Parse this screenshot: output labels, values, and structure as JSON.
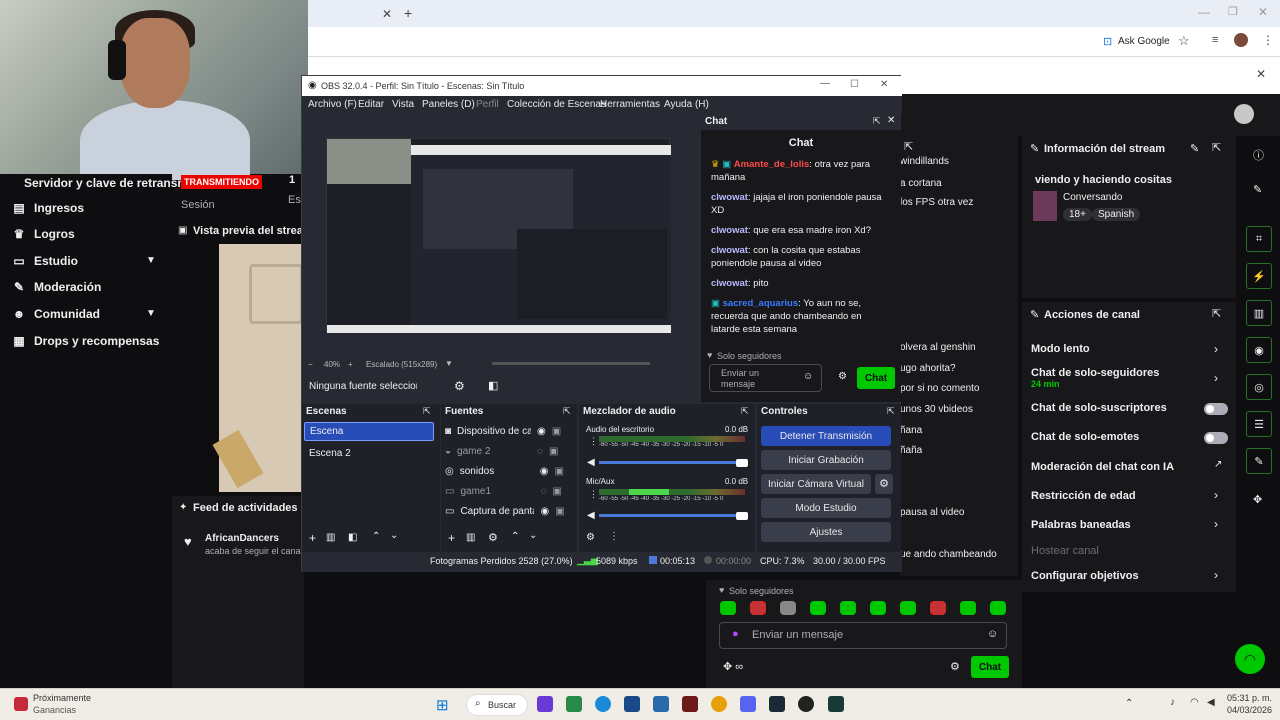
{
  "browser": {
    "ask_google": "Ask Google"
  },
  "webcam": {},
  "twitch": {
    "server_key": "Servidor y clave de retransm",
    "live_badge": "TRANSMITIENDO",
    "count_1": "1",
    "session": "Sesión",
    "session_right": "Es",
    "nav": [
      {
        "label": "Ingresos",
        "icon": "money-icon"
      },
      {
        "label": "Logros",
        "icon": "trophy-icon"
      },
      {
        "label": "Estudio",
        "icon": "studio-icon"
      },
      {
        "label": "Moderación",
        "icon": "wrench-icon"
      },
      {
        "label": "Comunidad",
        "icon": "people-icon"
      },
      {
        "label": "Drops y recompensas",
        "icon": "gift-icon"
      }
    ],
    "preview_title": "Vista previa del stream",
    "feed_title": "Feed de actividades",
    "feed_user": "AfricanDancers",
    "feed_action": "acaba de seguir el canal",
    "stream_info": {
      "title": "Información del stream",
      "stream_title": "viendo y haciendo cositas",
      "category": "Conversando",
      "tags": [
        "18+",
        "Spanish"
      ]
    },
    "channel_actions": {
      "title": "Acciones de canal",
      "items": [
        {
          "label": "Modo lento",
          "control": "chevron"
        },
        {
          "label": "Chat de solo-seguidores",
          "sub": "24 min",
          "control": "chevron"
        },
        {
          "label": "Chat de solo-suscriptores",
          "control": "toggle"
        },
        {
          "label": "Chat de solo-emotes",
          "control": "toggle"
        },
        {
          "label": "Moderación del chat con IA",
          "control": "external"
        },
        {
          "label": "Restricción de edad",
          "control": "chevron"
        },
        {
          "label": "Palabras baneadas",
          "control": "chevron"
        },
        {
          "label": "Hostear canal",
          "control": "none",
          "disabled": true
        },
        {
          "label": "Configurar objetivos",
          "control": "chevron"
        }
      ]
    },
    "behind_chat": {
      "lines": [
        "windillands",
        "a cortana",
        "los FPS otra vez",
        "olvera al genshin",
        "ugo ahorita?",
        "por si no comento",
        "unos 30 vbideos",
        "ñana",
        "ñaña",
        "pausa al video",
        "ue ando chambeando"
      ]
    },
    "bottom_chat": {
      "followers_only": "Solo seguidores",
      "placeholder": "Enviar un mensaje",
      "send": "Chat"
    }
  },
  "obs": {
    "title": "OBS 32.0.4 - Perfil: Sin Título - Escenas: Sin Título",
    "menu": [
      "Archivo (F)",
      "Editar",
      "Vista",
      "Paneles (D)",
      "Perfil",
      "Colección de Escenas",
      "Herramientas",
      "Ayuda (H)"
    ],
    "zoom": "40%",
    "scaling": "Escalado (515x289)",
    "no_source": "Ninguna fuente seleccionad",
    "chat": {
      "dock_title": "Chat",
      "header": "Chat",
      "messages": [
        {
          "user": "Amante_de_lolis",
          "text": ": otra vez para mañana",
          "color": "#ff4a4a"
        },
        {
          "user": "clwowat",
          "text": ": jajaja el iron poniendole pausa XD",
          "color": "#b8b8ff"
        },
        {
          "user": "clwowat",
          "text": ": que era esa madre iron Xd?",
          "color": "#b8b8ff"
        },
        {
          "user": "clwowat",
          "text": ": con la cosita que estabas poniendole pausa al video",
          "color": "#b8b8ff"
        },
        {
          "user": "clwowat",
          "text": ": pito",
          "color": "#b8b8ff"
        },
        {
          "user": "sacred_aquarius",
          "text": ": Yo aun no se, recuerda que ando chambeando en latarde esta semana",
          "color": "#3b7bff"
        }
      ],
      "followers_only": "Solo seguidores",
      "placeholder": "Enviar un mensaje",
      "send": "Chat"
    },
    "scenes": {
      "title": "Escenas",
      "items": [
        "Escena",
        "Escena 2"
      ]
    },
    "sources": {
      "title": "Fuentes",
      "items": [
        {
          "label": "Dispositivo de capt",
          "icon": "camera-icon",
          "visible": true
        },
        {
          "label": "game 2",
          "icon": "gamepad-icon",
          "visible": false
        },
        {
          "label": "sonidos",
          "icon": "audio-icon",
          "visible": true
        },
        {
          "label": "game1",
          "icon": "window-icon",
          "visible": false
        },
        {
          "label": "Captura de pantall",
          "icon": "monitor-icon",
          "visible": true
        }
      ]
    },
    "mixer": {
      "title": "Mezclador de audio",
      "channels": [
        {
          "name": "Audio del escritorio",
          "db": "0.0 dB"
        },
        {
          "name": "Mic/Aux",
          "db": "0.0 dB"
        }
      ],
      "scale": "-60 -55 -50 -45 -40 -35 -30 -25 -20 -15 -10 -5 0"
    },
    "controls": {
      "title": "Controles",
      "buttons": [
        "Detener Transmisión",
        "Iniciar Grabación",
        "Iniciar Cámara Virtual",
        "Modo Estudio",
        "Ajustes"
      ]
    },
    "status": {
      "dropped": "Fotogramas Perdidos 2528 (27.0%)",
      "kbps": "5089 kbps",
      "live_time": "00:05:13",
      "rec_time": "00:00:00",
      "cpu": "CPU: 7.3%",
      "fps": "30.00 / 30.00 FPS"
    }
  },
  "taskbar": {
    "widget_title": "Próximamente",
    "widget_sub": "Ganancias",
    "search": "Buscar",
    "time": "05:31 p. m.",
    "date": "04/03/2026"
  },
  "colors": {
    "twitch_green": "#00c800",
    "obs_accent": "#284cb8",
    "live_red": "#eb0400"
  }
}
